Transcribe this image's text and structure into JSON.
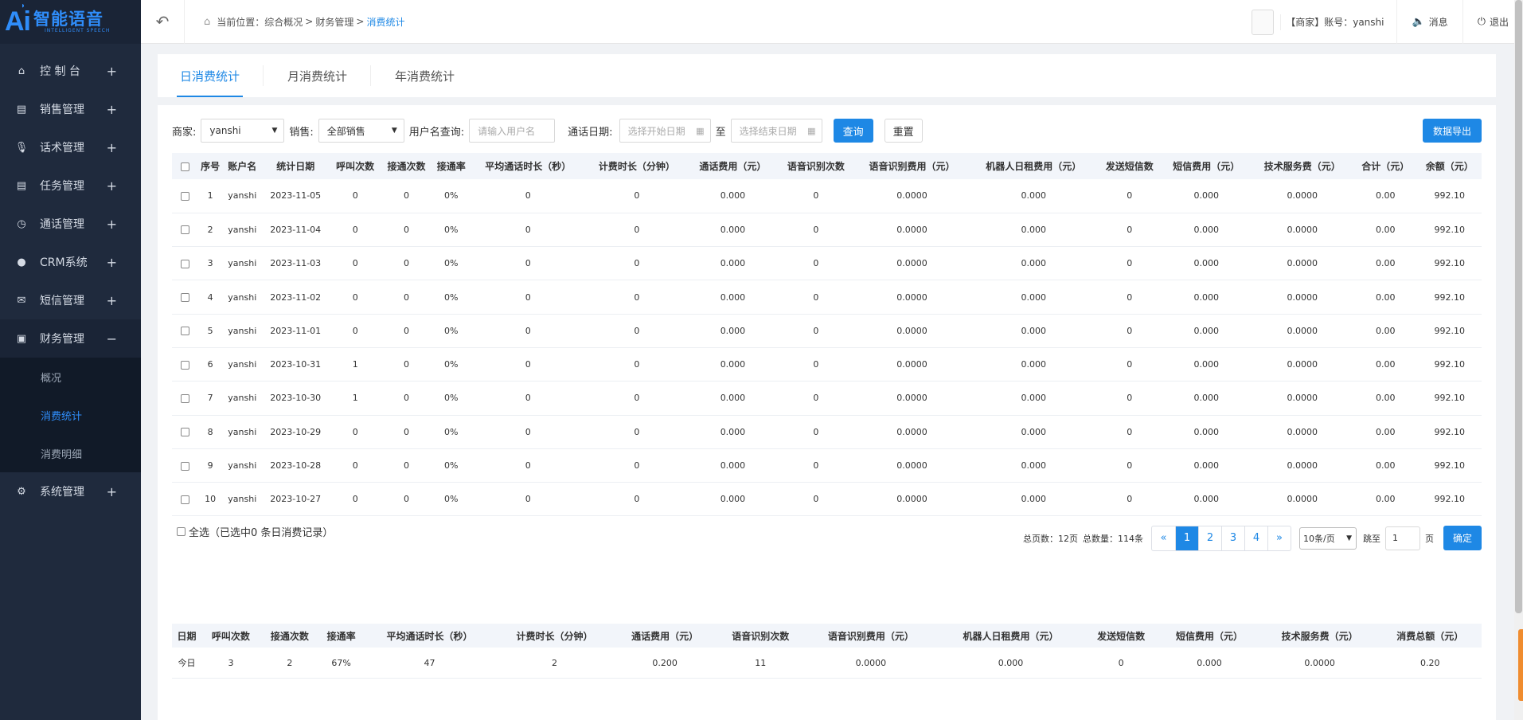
{
  "logo": {
    "ai": "Ai",
    "name": "智能语音",
    "tagline": "INTELLIGENT SPEECH"
  },
  "sidebar": {
    "items": [
      {
        "label": "控 制 台",
        "icon": "home-icon",
        "toggle": "+"
      },
      {
        "label": "销售管理",
        "icon": "clipboard-icon",
        "toggle": "+"
      },
      {
        "label": "话术管理",
        "icon": "microphone-icon",
        "toggle": "+"
      },
      {
        "label": "任务管理",
        "icon": "clipboard-icon",
        "toggle": "+"
      },
      {
        "label": "通话管理",
        "icon": "phone-clock-icon",
        "toggle": "+"
      },
      {
        "label": "CRM系统",
        "icon": "user-icon",
        "toggle": "+"
      },
      {
        "label": "短信管理",
        "icon": "envelope-icon",
        "toggle": "+"
      },
      {
        "label": "财务管理",
        "icon": "wallet-icon",
        "toggle": "−"
      }
    ],
    "finance_sub": [
      {
        "label": "概况"
      },
      {
        "label": "消费统计"
      },
      {
        "label": "消费明细"
      }
    ],
    "system": {
      "label": "系统管理",
      "icon": "gear-icon",
      "toggle": "+"
    }
  },
  "topbar": {
    "crumb_prefix": "当前位置：",
    "crumb1": "综合概况",
    "crumb2": "财务管理",
    "crumb3": "消费统计",
    "sep": ">",
    "account": "【商家】账号：yanshi",
    "message": "消息",
    "logout": "退出"
  },
  "tabs": [
    "日消费统计",
    "月消费统计",
    "年消费统计"
  ],
  "filters": {
    "merchant_label": "商家:",
    "merchant_value": "yanshi",
    "sales_label": "销售:",
    "sales_value": "全部销售",
    "user_label": "用户名查询:",
    "user_placeholder": "请输入用户名",
    "date_label": "通话日期:",
    "start_placeholder": "选择开始日期",
    "to": "至",
    "end_placeholder": "选择结束日期",
    "query": "查询",
    "reset": "重置",
    "export": "数据导出"
  },
  "table": {
    "headers": [
      "序号",
      "账户名",
      "统计日期",
      "呼叫次数",
      "接通次数",
      "接通率",
      "平均通话时长（秒）",
      "计费时长（分钟）",
      "通话费用（元）",
      "语音识别次数",
      "语音识别费用（元）",
      "机器人日租费用（元）",
      "发送短信数",
      "短信费用（元）",
      "技术服务费（元）",
      "合计（元）",
      "余额（元）"
    ],
    "rows": [
      [
        "1",
        "yanshi",
        "2023-11-05",
        "0",
        "0",
        "0%",
        "0",
        "0",
        "0.000",
        "0",
        "0.0000",
        "0.000",
        "0",
        "0.000",
        "0.0000",
        "0.00",
        "992.10"
      ],
      [
        "2",
        "yanshi",
        "2023-11-04",
        "0",
        "0",
        "0%",
        "0",
        "0",
        "0.000",
        "0",
        "0.0000",
        "0.000",
        "0",
        "0.000",
        "0.0000",
        "0.00",
        "992.10"
      ],
      [
        "3",
        "yanshi",
        "2023-11-03",
        "0",
        "0",
        "0%",
        "0",
        "0",
        "0.000",
        "0",
        "0.0000",
        "0.000",
        "0",
        "0.000",
        "0.0000",
        "0.00",
        "992.10"
      ],
      [
        "4",
        "yanshi",
        "2023-11-02",
        "0",
        "0",
        "0%",
        "0",
        "0",
        "0.000",
        "0",
        "0.0000",
        "0.000",
        "0",
        "0.000",
        "0.0000",
        "0.00",
        "992.10"
      ],
      [
        "5",
        "yanshi",
        "2023-11-01",
        "0",
        "0",
        "0%",
        "0",
        "0",
        "0.000",
        "0",
        "0.0000",
        "0.000",
        "0",
        "0.000",
        "0.0000",
        "0.00",
        "992.10"
      ],
      [
        "6",
        "yanshi",
        "2023-10-31",
        "1",
        "0",
        "0%",
        "0",
        "0",
        "0.000",
        "0",
        "0.0000",
        "0.000",
        "0",
        "0.000",
        "0.0000",
        "0.00",
        "992.10"
      ],
      [
        "7",
        "yanshi",
        "2023-10-30",
        "1",
        "0",
        "0%",
        "0",
        "0",
        "0.000",
        "0",
        "0.0000",
        "0.000",
        "0",
        "0.000",
        "0.0000",
        "0.00",
        "992.10"
      ],
      [
        "8",
        "yanshi",
        "2023-10-29",
        "0",
        "0",
        "0%",
        "0",
        "0",
        "0.000",
        "0",
        "0.0000",
        "0.000",
        "0",
        "0.000",
        "0.0000",
        "0.00",
        "992.10"
      ],
      [
        "9",
        "yanshi",
        "2023-10-28",
        "0",
        "0",
        "0%",
        "0",
        "0",
        "0.000",
        "0",
        "0.0000",
        "0.000",
        "0",
        "0.000",
        "0.0000",
        "0.00",
        "992.10"
      ],
      [
        "10",
        "yanshi",
        "2023-10-27",
        "0",
        "0",
        "0%",
        "0",
        "0",
        "0.000",
        "0",
        "0.0000",
        "0.000",
        "0",
        "0.000",
        "0.0000",
        "0.00",
        "992.10"
      ]
    ]
  },
  "select_all": "全选（已选中0 条日消费记录）",
  "pager": {
    "total_pages_label": "总页数：12页",
    "total_count_label": "总数量：114条",
    "prev": "«",
    "pages": [
      "1",
      "2",
      "3",
      "4"
    ],
    "next": "»",
    "page_size": "10条/页",
    "goto_label": "跳至",
    "goto_value": "1",
    "page_unit": "页",
    "confirm": "确定"
  },
  "summary": {
    "headers": [
      "日期",
      "呼叫次数",
      "接通次数",
      "接通率",
      "平均通话时长（秒）",
      "计费时长（分钟）",
      "通话费用（元）",
      "语音识别次数",
      "语音识别费用（元）",
      "机器人日租费用（元）",
      "发送短信数",
      "短信费用（元）",
      "技术服务费（元）",
      "消费总额（元）"
    ],
    "row": [
      "今日",
      "3",
      "2",
      "67%",
      "47",
      "2",
      "0.200",
      "11",
      "0.0000",
      "0.000",
      "0",
      "0.000",
      "0.0000",
      "0.20"
    ]
  }
}
